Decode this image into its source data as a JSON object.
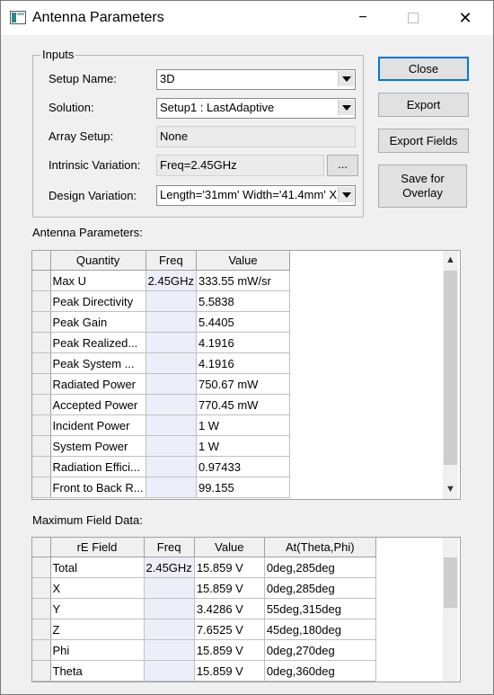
{
  "window": {
    "title": "Antenna Parameters",
    "minimize": "−",
    "close": "✕"
  },
  "inputs": {
    "legend": "Inputs",
    "setup_name": {
      "label": "Setup Name:",
      "value": "3D"
    },
    "solution": {
      "label": "Solution:",
      "value": "Setup1 : LastAdaptive"
    },
    "array_setup": {
      "label": "Array Setup:",
      "value": "None"
    },
    "intrinsic_variation": {
      "label": "Intrinsic Variation:",
      "value": "Freq=2.45GHz",
      "button": "..."
    },
    "design_variation": {
      "label": "Design Variation:",
      "value": "Length='31mm' Width='41.4mm' X"
    }
  },
  "buttons": {
    "close": "Close",
    "export": "Export",
    "export_fields": "Export Fields",
    "save_overlay_1": "Save for",
    "save_overlay_2": "Overlay"
  },
  "antenna_params": {
    "title": "Antenna Parameters:",
    "headers": {
      "quantity": "Quantity",
      "freq": "Freq",
      "value": "Value"
    },
    "rows": [
      {
        "q": "Max U",
        "f": "2.45GHz",
        "v": "333.55 mW/sr"
      },
      {
        "q": "Peak Directivity",
        "f": "",
        "v": "5.5838"
      },
      {
        "q": "Peak Gain",
        "f": "",
        "v": "5.4405"
      },
      {
        "q": "Peak Realized...",
        "f": "",
        "v": "4.1916"
      },
      {
        "q": "Peak System ...",
        "f": "",
        "v": "4.1916"
      },
      {
        "q": "Radiated Power",
        "f": "",
        "v": "750.67 mW"
      },
      {
        "q": "Accepted Power",
        "f": "",
        "v": "770.45 mW"
      },
      {
        "q": "Incident Power",
        "f": "",
        "v": "1 W"
      },
      {
        "q": "System Power",
        "f": "",
        "v": "1 W"
      },
      {
        "q": "Radiation Effici...",
        "f": "",
        "v": "0.97433"
      },
      {
        "q": "Front to Back R...",
        "f": "",
        "v": "99.155"
      }
    ]
  },
  "max_field": {
    "title": "Maximum Field Data:",
    "headers": {
      "field": "rE Field",
      "freq": "Freq",
      "value": "Value",
      "at": "At(Theta,Phi)"
    },
    "rows": [
      {
        "q": "Total",
        "f": "2.45GHz",
        "v": "15.859 V",
        "a": "0deg,285deg"
      },
      {
        "q": "X",
        "f": "",
        "v": "15.859 V",
        "a": "0deg,285deg"
      },
      {
        "q": "Y",
        "f": "",
        "v": "3.4286 V",
        "a": "55deg,315deg"
      },
      {
        "q": "Z",
        "f": "",
        "v": "7.6525 V",
        "a": "45deg,180deg"
      },
      {
        "q": "Phi",
        "f": "",
        "v": "15.859 V",
        "a": "0deg,270deg"
      },
      {
        "q": "Theta",
        "f": "",
        "v": "15.859 V",
        "a": "0deg,360deg"
      }
    ]
  },
  "icons": {
    "scroll_up": "▲",
    "scroll_down": "▼"
  }
}
